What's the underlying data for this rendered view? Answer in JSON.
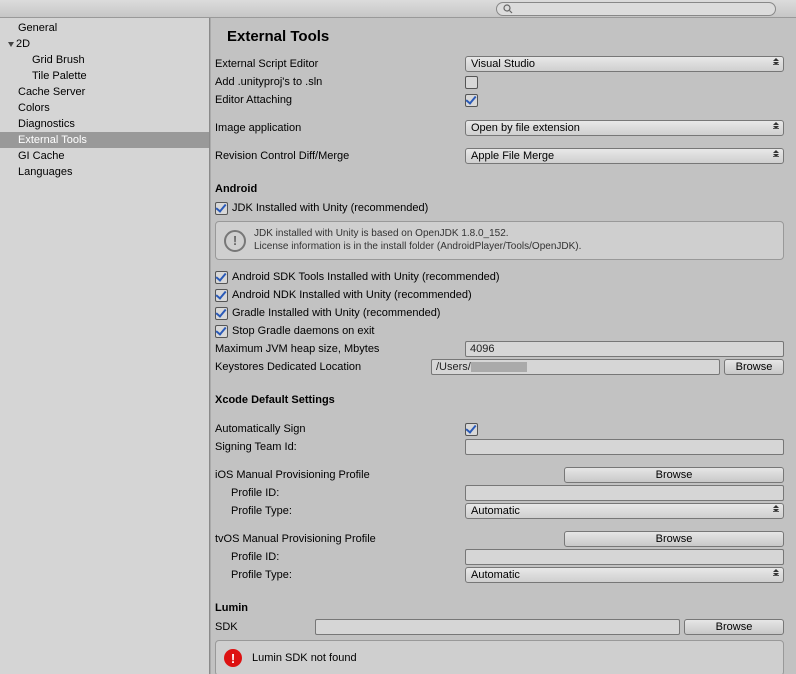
{
  "topbar": {
    "search_placeholder": ""
  },
  "sidebar": {
    "items": [
      {
        "label": "General"
      },
      {
        "label": "2D",
        "children": [
          {
            "label": "Grid Brush"
          },
          {
            "label": "Tile Palette"
          }
        ]
      },
      {
        "label": "Cache Server"
      },
      {
        "label": "Colors"
      },
      {
        "label": "Diagnostics"
      },
      {
        "label": "External Tools",
        "selected": true
      },
      {
        "label": "GI Cache"
      },
      {
        "label": "Languages"
      }
    ]
  },
  "main": {
    "title": "External Tools",
    "script_editor_label": "External Script Editor",
    "script_editor_value": "Visual Studio",
    "add_unityproj_label": "Add .unityproj's to .sln",
    "add_unityproj_checked": false,
    "editor_attach_label": "Editor Attaching",
    "editor_attach_checked": true,
    "image_app_label": "Image application",
    "image_app_value": "Open by file extension",
    "revctl_label": "Revision Control Diff/Merge",
    "revctl_value": "Apple File Merge",
    "android_header": "Android",
    "jdk_label": "JDK Installed with Unity (recommended)",
    "jdk_info_1": "JDK installed with Unity is based on OpenJDK 1.8.0_152.",
    "jdk_info_2": "License information is in the install folder (AndroidPlayer/Tools/OpenJDK).",
    "sdk_tools_label": "Android SDK Tools Installed with Unity (recommended)",
    "ndk_label": "Android NDK Installed with Unity (recommended)",
    "gradle_label": "Gradle Installed with Unity (recommended)",
    "stop_gradle_label": "Stop Gradle daemons on exit",
    "max_jvm_label": "Maximum JVM heap size, Mbytes",
    "max_jvm_value": "4096",
    "keystore_label": "Keystores Dedicated Location",
    "keystore_value": "/Users/",
    "browse_label": "Browse",
    "xcode_header": "Xcode Default Settings",
    "auto_sign_label": "Automatically Sign",
    "auto_sign_checked": true,
    "signing_team_label": "Signing Team Id:",
    "signing_team_value": "",
    "ios_prov_header": "iOS Manual Provisioning Profile",
    "profile_id_label": "Profile ID:",
    "profile_type_label": "Profile Type:",
    "profile_type_value": "Automatic",
    "tvos_prov_header": "tvOS Manual Provisioning Profile",
    "lumin_header": "Lumin",
    "lumin_sdk_label": "SDK",
    "lumin_sdk_value": "",
    "lumin_warn": "Lumin SDK not found"
  }
}
